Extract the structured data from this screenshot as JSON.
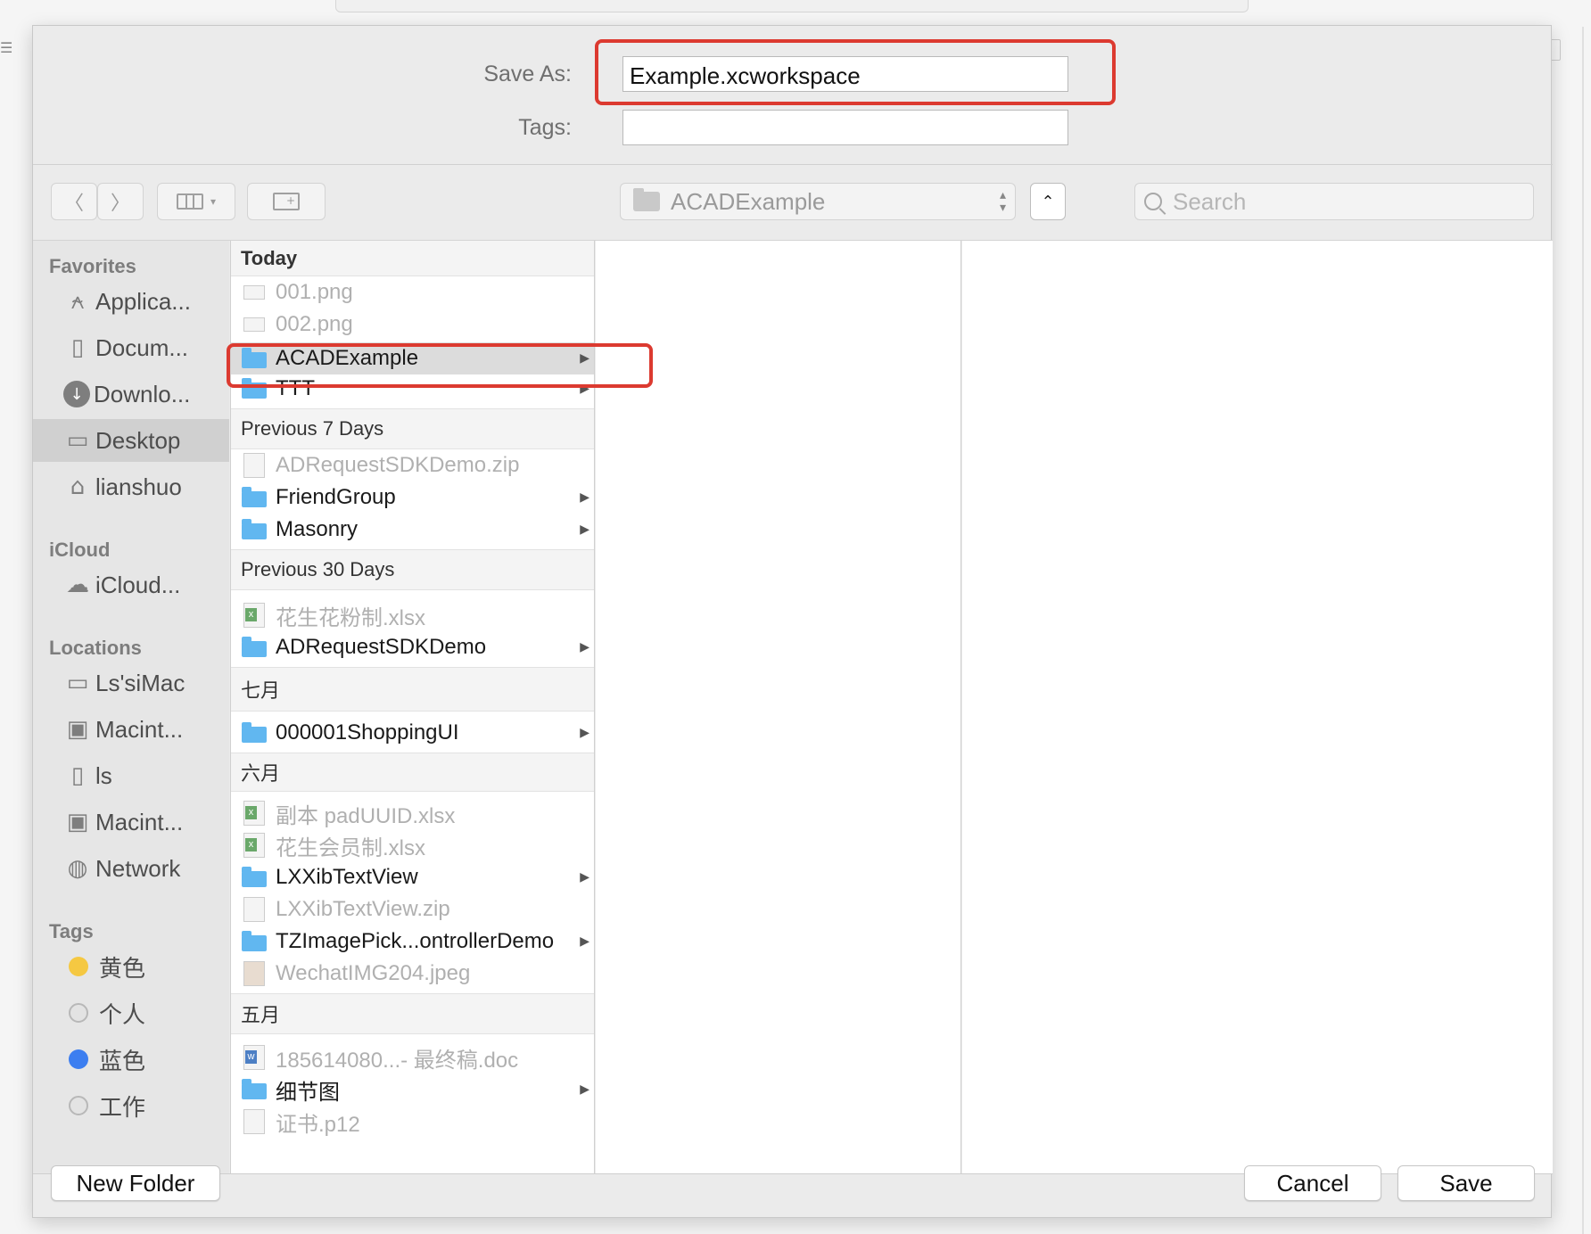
{
  "dialog": {
    "save_as_label": "Save As:",
    "save_as_value": "Example.xcworkspace",
    "tags_label": "Tags:",
    "tags_value": ""
  },
  "toolbar": {
    "back_icon": "chevron-left-icon",
    "forward_icon": "chevron-right-icon",
    "view_icon": "column-view-icon",
    "new_folder_icon": "new-folder-icon",
    "path_label": "ACADExample",
    "expand_icon": "chevron-up-icon",
    "search_placeholder": "Search"
  },
  "sidebar": {
    "favorites_header": "Favorites",
    "favorites": [
      {
        "label": "Applica...",
        "icon": "applications-icon"
      },
      {
        "label": "Docum...",
        "icon": "documents-icon"
      },
      {
        "label": "Downlo...",
        "icon": "downloads-icon"
      },
      {
        "label": "Desktop",
        "icon": "desktop-icon",
        "selected": true
      },
      {
        "label": "lianshuo",
        "icon": "home-icon"
      }
    ],
    "icloud_header": "iCloud",
    "icloud": [
      {
        "label": "iCloud...",
        "icon": "cloud-icon"
      }
    ],
    "locations_header": "Locations",
    "locations": [
      {
        "label": "Ls'siMac",
        "icon": "computer-icon"
      },
      {
        "label": "Macint...",
        "icon": "disk-icon"
      },
      {
        "label": "ls",
        "icon": "drive-icon"
      },
      {
        "label": "Macint...",
        "icon": "disk-icon"
      },
      {
        "label": "Network",
        "icon": "network-icon"
      }
    ],
    "tags_header": "Tags",
    "tags": [
      {
        "label": "黄色",
        "color": "#f5c842"
      },
      {
        "label": "个人",
        "color": "#e3e3e3"
      },
      {
        "label": "蓝色",
        "color": "#3c7ef0"
      },
      {
        "label": "工作",
        "color": "#e3e3e3"
      }
    ]
  },
  "column1": {
    "sections": [
      {
        "header": "Today",
        "items": [
          {
            "name": "001.png",
            "type": "png",
            "enabled": false
          },
          {
            "name": "002.png",
            "type": "png",
            "enabled": false
          },
          {
            "name": "ACADExample",
            "type": "folder",
            "enabled": true,
            "selected": true
          },
          {
            "name": "TTT",
            "type": "folder",
            "enabled": true
          }
        ]
      },
      {
        "header": "Previous 7 Days",
        "items": [
          {
            "name": "ADRequestSDKDemo.zip",
            "type": "zip",
            "enabled": false
          },
          {
            "name": "FriendGroup",
            "type": "folder",
            "enabled": true
          },
          {
            "name": "Masonry",
            "type": "folder",
            "enabled": true
          }
        ]
      },
      {
        "header": "Previous 30 Days",
        "items": [
          {
            "name": "花生花粉制.xlsx",
            "type": "xls",
            "enabled": false
          },
          {
            "name": "ADRequestSDKDemo",
            "type": "folder",
            "enabled": true
          }
        ]
      },
      {
        "header": "七月",
        "items": [
          {
            "name": "000001ShoppingUI",
            "type": "folder",
            "enabled": true
          }
        ]
      },
      {
        "header": "六月",
        "items": [
          {
            "name": "副本 padUUID.xlsx",
            "type": "xls",
            "enabled": false
          },
          {
            "name": "花生会员制.xlsx",
            "type": "xls",
            "enabled": false
          },
          {
            "name": "LXXibTextView",
            "type": "folder",
            "enabled": true
          },
          {
            "name": "LXXibTextView.zip",
            "type": "zip",
            "enabled": false
          },
          {
            "name": "TZImagePick...ontrollerDemo",
            "type": "folder",
            "enabled": true
          },
          {
            "name": "WechatIMG204.jpeg",
            "type": "img",
            "enabled": false
          }
        ]
      },
      {
        "header": "五月",
        "items": [
          {
            "name": "185614080...- 最终稿.doc",
            "type": "doc",
            "enabled": false
          },
          {
            "name": "细节图",
            "type": "folder",
            "enabled": true
          },
          {
            "name": "证书.p12",
            "type": "file",
            "enabled": false
          }
        ]
      }
    ]
  },
  "buttons": {
    "new_folder": "New Folder",
    "cancel": "Cancel",
    "save": "Save"
  },
  "colors": {
    "annotation": "#dc3a30",
    "folder": "#61b7f0"
  }
}
